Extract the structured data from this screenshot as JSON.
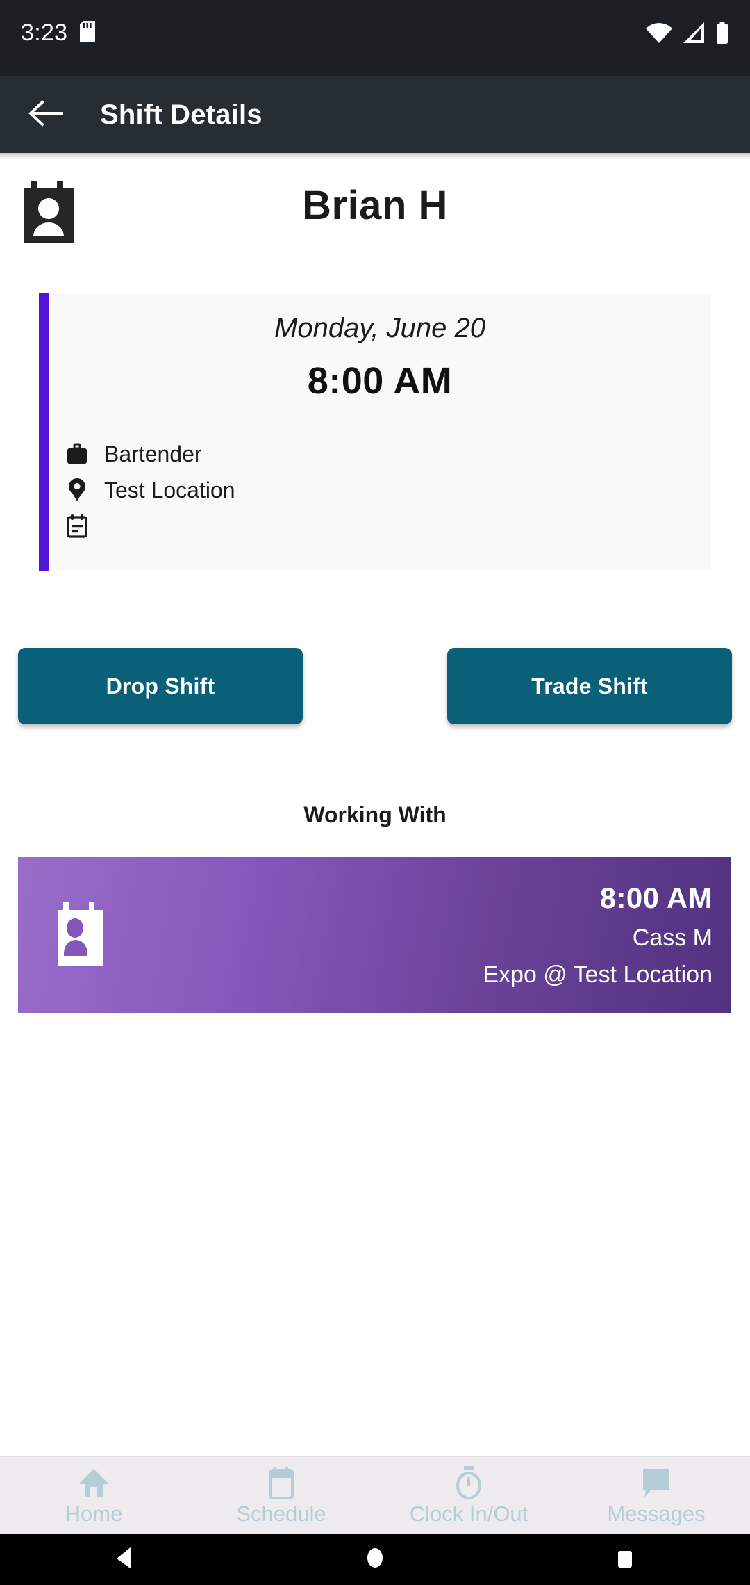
{
  "status_bar": {
    "time": "3:23",
    "icons": [
      "sd-card-icon",
      "wifi-icon",
      "cellular-signal-icon",
      "battery-icon"
    ]
  },
  "app_bar": {
    "back_icon": "arrow-left-icon",
    "title": "Shift Details"
  },
  "profile": {
    "avatar_icon": "contact-card-icon",
    "name": "Brian H"
  },
  "shift_card": {
    "accent_color": "#5113d6",
    "date": "Monday, June 20",
    "time": "8:00 AM",
    "meta": [
      {
        "icon": "briefcase-icon",
        "label": "Bartender"
      },
      {
        "icon": "location-pin-icon",
        "label": "Test Location"
      },
      {
        "icon": "calendar-note-icon",
        "label": ""
      }
    ]
  },
  "actions": {
    "drop_label": "Drop Shift",
    "trade_label": "Trade Shift",
    "color": "#0b6079"
  },
  "working_with": {
    "title": "Working With",
    "coworkers": [
      {
        "avatar_icon": "contact-card-icon",
        "time": "8:00 AM",
        "name": "Cass M",
        "role_location": "Expo @ Test Location",
        "gradient_from": "#9a6dcb",
        "gradient_to": "#523280"
      }
    ]
  },
  "bottom_nav": {
    "items": [
      {
        "icon": "home-icon",
        "label": "Home"
      },
      {
        "icon": "calendar-icon",
        "label": "Schedule"
      },
      {
        "icon": "stopwatch-icon",
        "label": "Clock In/Out"
      },
      {
        "icon": "message-icon",
        "label": "Messages"
      }
    ],
    "inactive_color": "#b4cdd6"
  },
  "system_nav": {
    "buttons": [
      "back-triangle-icon",
      "home-circle-icon",
      "recents-square-icon"
    ]
  }
}
